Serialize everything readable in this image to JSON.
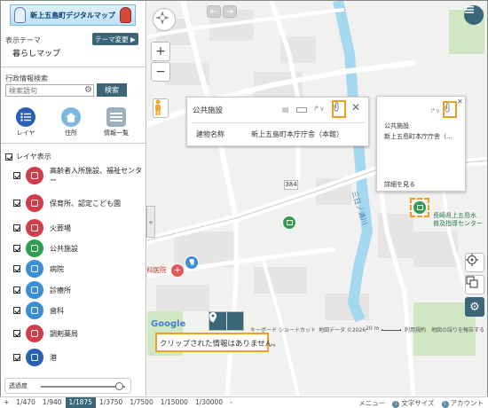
{
  "header": {
    "logo_title": "新上五島町デジタルマップ"
  },
  "theme": {
    "label": "表示テーマ",
    "name": "暮らしマップ",
    "change_button": "テーマ変更 ▶"
  },
  "search": {
    "label": "行政情報検索",
    "placeholder": "検索語句",
    "button": "検索"
  },
  "nav": [
    {
      "label": "レイヤ",
      "icon": "layers-icon"
    },
    {
      "label": "住所",
      "icon": "house-icon"
    },
    {
      "label": "情報一覧",
      "icon": "list-icon"
    }
  ],
  "layers": {
    "header": "レイヤ表示",
    "items": [
      {
        "label": "高齢者入所施設、福祉センター",
        "icon": "elderly-facility-icon",
        "color": "#d33c4a"
      },
      {
        "label": "保育所、認定こども園",
        "icon": "nursery-icon",
        "color": "#d33c4a"
      },
      {
        "label": "火葬場",
        "icon": "crematorium-icon",
        "color": "#d33c4a"
      },
      {
        "label": "公共施設",
        "icon": "public-facility-icon",
        "color": "#2f9c4f"
      },
      {
        "label": "病院",
        "icon": "hospital-icon",
        "color": "#3a8ed6"
      },
      {
        "label": "診療所",
        "icon": "clinic-icon",
        "color": "#3a8ed6"
      },
      {
        "label": "歯科",
        "icon": "dental-icon",
        "color": "#3a8ed6"
      },
      {
        "label": "調剤薬局",
        "icon": "pharmacy-icon",
        "color": "#d33c4a"
      },
      {
        "label": "港",
        "icon": "port-icon",
        "color": "#2a5fb8"
      }
    ]
  },
  "opacity": {
    "label": "透過度",
    "value": 0.93
  },
  "popup_main": {
    "title": "公共施設",
    "field_label": "建物名称",
    "field_value": "新上五島町本庁庁舎（本館）"
  },
  "popup_side": {
    "category": "公共施設",
    "name": "新上五島町本庁庁舎（...",
    "more_link": "詳細を見る"
  },
  "map_labels": {
    "river": "三日ノ浦川",
    "route": "384",
    "hospital_fragment": "科医院",
    "building_line1": "長崎県上五島水",
    "building_line2": "普及指導センター",
    "attribution": "キーボード ショートカット",
    "map_data": "地図データ ©2026",
    "scale": "20 m",
    "terms": "利用規約",
    "report": "地図の誤りを報告する",
    "google": "Google"
  },
  "clip_message": "クリップされた情報はありません。",
  "scales": [
    "1/470",
    "1/940",
    "1/1875",
    "1/3750",
    "1/7500",
    "1/15000",
    "1/30000"
  ],
  "scale_active": "1/1875",
  "scale_prev": "+",
  "scale_next": "-",
  "footer": {
    "menu": "メニュー",
    "font_size": "文字サイズ",
    "account": "アカウント"
  }
}
